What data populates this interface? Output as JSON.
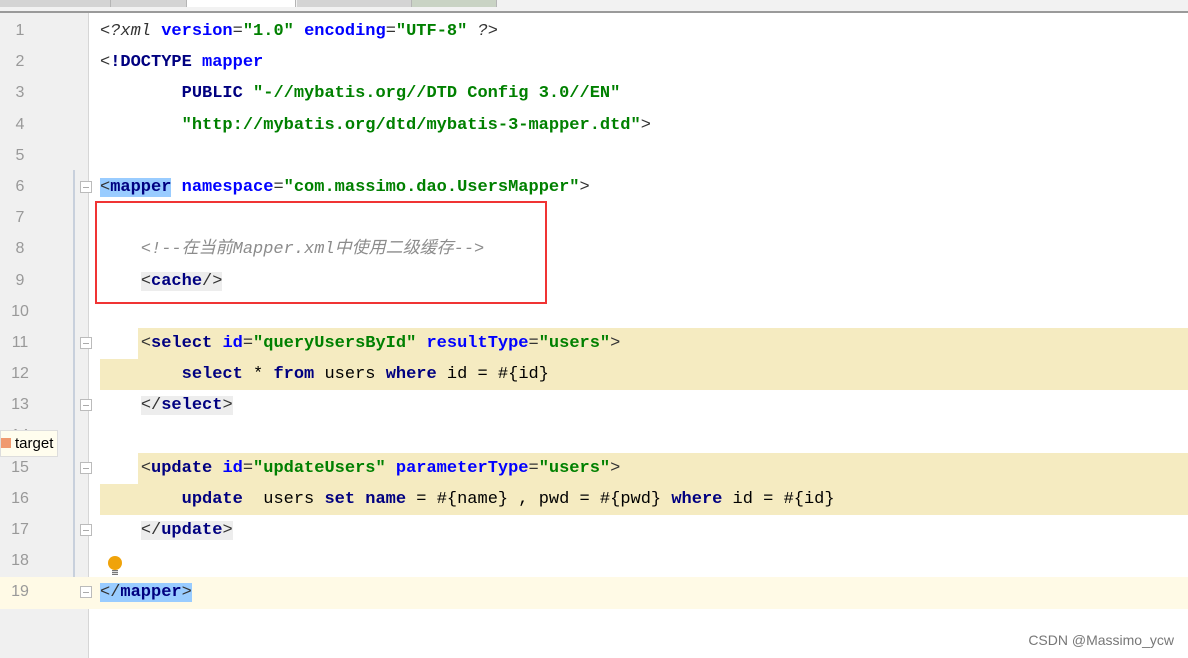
{
  "editor": {
    "lines": [
      {
        "n": "1",
        "tokens": [
          [
            "t-pi",
            "<?"
          ],
          [
            "t-pi",
            "xml "
          ],
          [
            "t-attr",
            "version"
          ],
          [
            "t-br",
            "="
          ],
          [
            "t-val",
            "\"1.0\""
          ],
          [
            "t-txt",
            " "
          ],
          [
            "t-attr",
            "encoding"
          ],
          [
            "t-br",
            "="
          ],
          [
            "t-val",
            "\"UTF-8\""
          ],
          [
            "t-pi",
            " ?>"
          ]
        ]
      },
      {
        "n": "2",
        "tokens": [
          [
            "t-br",
            "<"
          ],
          [
            "t-tag",
            "!DOCTYPE "
          ],
          [
            "t-attr",
            "mapper"
          ]
        ]
      },
      {
        "n": "3",
        "tokens": [
          [
            "t-txt",
            "        "
          ],
          [
            "t-tag",
            "PUBLIC "
          ],
          [
            "t-val",
            "\"-//mybatis.org//DTD Config 3.0//EN\""
          ]
        ]
      },
      {
        "n": "4",
        "tokens": [
          [
            "t-txt",
            "        "
          ],
          [
            "t-val",
            "\"http://mybatis.org/dtd/mybatis-3-mapper.dtd\""
          ],
          [
            "t-br",
            ">"
          ]
        ]
      },
      {
        "n": "5",
        "tokens": []
      },
      {
        "n": "6",
        "tokens": [
          [
            "t-br hl-match",
            "<"
          ],
          [
            "t-tag hl-match",
            "mapper"
          ],
          [
            "t-txt",
            " "
          ],
          [
            "t-attr",
            "namespace"
          ],
          [
            "t-br",
            "="
          ],
          [
            "t-val",
            "\"com.massimo.dao.UsersMapper\""
          ],
          [
            "t-br",
            ">"
          ]
        ]
      },
      {
        "n": "7",
        "tokens": []
      },
      {
        "n": "8",
        "tokens": [
          [
            "t-txt",
            "    "
          ],
          [
            "t-com",
            "<!--在当前Mapper.xml中使用二级缓存-->"
          ]
        ]
      },
      {
        "n": "9",
        "tokens": [
          [
            "t-txt",
            "    "
          ],
          [
            "t-br hl-tag",
            "<"
          ],
          [
            "t-tag hl-tag",
            "cache"
          ],
          [
            "t-br hl-tag",
            "/>"
          ]
        ]
      },
      {
        "n": "10",
        "tokens": []
      },
      {
        "n": "11",
        "tokens": [
          [
            "t-txt",
            "    "
          ],
          [
            "t-br",
            "<"
          ],
          [
            "t-tag",
            "select "
          ],
          [
            "t-attr",
            "id"
          ],
          [
            "t-br",
            "="
          ],
          [
            "t-val",
            "\"queryUsersById\""
          ],
          [
            "t-txt",
            " "
          ],
          [
            "t-attr",
            "resultType"
          ],
          [
            "t-br",
            "="
          ],
          [
            "t-val",
            "\"users\""
          ],
          [
            "t-br",
            ">"
          ]
        ]
      },
      {
        "n": "12",
        "tokens": [
          [
            "t-txt",
            "        "
          ],
          [
            "t-kw",
            "select"
          ],
          [
            "t-txt",
            " * "
          ],
          [
            "t-kw",
            "from"
          ],
          [
            "t-txt",
            " users "
          ],
          [
            "t-kw",
            "where"
          ],
          [
            "t-txt",
            " id = #{id}"
          ]
        ]
      },
      {
        "n": "13",
        "tokens": [
          [
            "t-txt",
            "    "
          ],
          [
            "t-br hl-tag",
            "</"
          ],
          [
            "t-tag hl-tag",
            "select"
          ],
          [
            "t-br hl-tag",
            ">"
          ]
        ]
      },
      {
        "n": "14",
        "tokens": []
      },
      {
        "n": "15",
        "tokens": [
          [
            "t-txt",
            "    "
          ],
          [
            "t-br",
            "<"
          ],
          [
            "t-tag",
            "update "
          ],
          [
            "t-attr",
            "id"
          ],
          [
            "t-br",
            "="
          ],
          [
            "t-val",
            "\"updateUsers\""
          ],
          [
            "t-txt",
            " "
          ],
          [
            "t-attr",
            "parameterType"
          ],
          [
            "t-br",
            "="
          ],
          [
            "t-val",
            "\"users\""
          ],
          [
            "t-br",
            ">"
          ]
        ]
      },
      {
        "n": "16",
        "tokens": [
          [
            "t-txt",
            "        "
          ],
          [
            "t-kw",
            "update"
          ],
          [
            "t-txt",
            "  users "
          ],
          [
            "t-kw",
            "set name"
          ],
          [
            "t-txt",
            " = #{name} , pwd = #{pwd} "
          ],
          [
            "t-kw",
            "where"
          ],
          [
            "t-txt",
            " id = #{id}"
          ]
        ]
      },
      {
        "n": "17",
        "tokens": [
          [
            "t-txt",
            "    "
          ],
          [
            "t-br hl-tag",
            "</"
          ],
          [
            "t-tag hl-tag",
            "update"
          ],
          [
            "t-br hl-tag",
            ">"
          ]
        ]
      },
      {
        "n": "18",
        "tokens": []
      },
      {
        "n": "19",
        "tokens": [
          [
            "t-br hl-match",
            "</"
          ],
          [
            "t-tag hl-match",
            "mapper"
          ],
          [
            "t-br hl-match",
            ">"
          ]
        ]
      }
    ],
    "yellow_lines": [
      "11",
      "12",
      "15",
      "16"
    ],
    "current_line": "19",
    "fold_lines": [
      "6",
      "11",
      "13",
      "15",
      "17",
      "19"
    ]
  },
  "tooltip": {
    "label": "target"
  },
  "watermark": "CSDN @Massimo_ycw",
  "colors": {
    "highlight_box": "#f03434",
    "sql_background": "#f5ebc1",
    "tag": "#000080",
    "attribute": "#0000ff",
    "value": "#008000"
  }
}
